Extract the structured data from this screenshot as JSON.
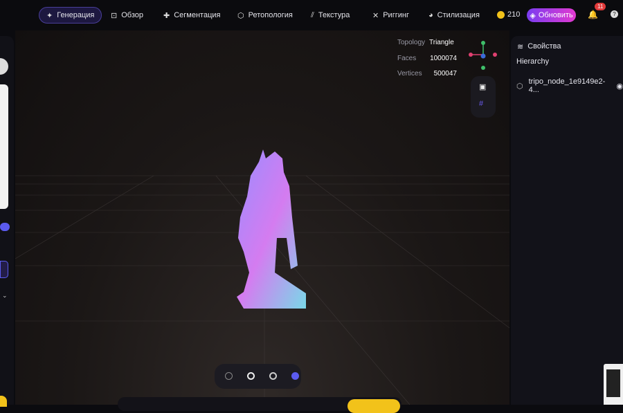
{
  "nav": [
    {
      "label": "Генерация",
      "icon": "sparkle-icon",
      "active": true
    },
    {
      "label": "Обзор",
      "icon": "scan-icon"
    },
    {
      "label": "Сегментация",
      "icon": "puzzle-icon"
    },
    {
      "label": "Ретопология",
      "icon": "mesh-icon"
    },
    {
      "label": "Текстура",
      "icon": "texture-icon"
    },
    {
      "label": "Риггинг",
      "icon": "figure-icon"
    },
    {
      "label": "Стилизация",
      "icon": "palette-icon"
    }
  ],
  "credits": "210",
  "upgrade_label": "Обновить",
  "notifications": "11",
  "stats": {
    "topology_label": "Topology",
    "topology": "Triangle",
    "faces_label": "Faces",
    "faces": "1000074",
    "vertices_label": "Vertices",
    "vertices": "500047"
  },
  "panel": {
    "title": "Свойства",
    "hierarchy": "Hierarchy",
    "node": "tripo_node_1e9149e2-4..."
  },
  "colors": {
    "accent": "#5b5bf0",
    "upgrade_start": "#7a3cf0",
    "upgrade_end": "#e23ad0"
  }
}
